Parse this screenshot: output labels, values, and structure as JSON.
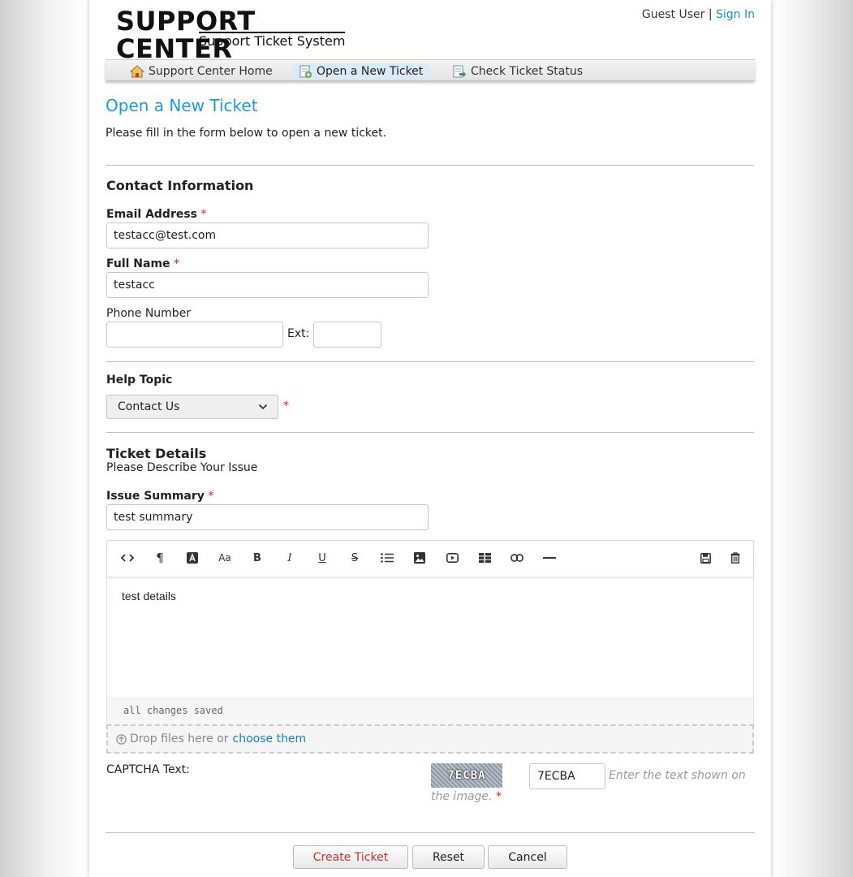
{
  "header": {
    "logo_title": "SUPPORT CENTER",
    "logo_subtitle": "Support Ticket System",
    "user_label": "Guest User |",
    "sign_in": "Sign In"
  },
  "nav": [
    {
      "label": "Support Center Home",
      "icon": "home-icon",
      "active": false
    },
    {
      "label": "Open a New Ticket",
      "icon": "new-ticket-icon",
      "active": true
    },
    {
      "label": "Check Ticket Status",
      "icon": "ticket-status-icon",
      "active": false
    }
  ],
  "page": {
    "title": "Open a New Ticket",
    "intro": "Please fill in the form below to open a new ticket."
  },
  "contact": {
    "heading": "Contact Information",
    "email_label": "Email Address",
    "email_value": "testacc@test.com",
    "name_label": "Full Name",
    "name_value": "testacc",
    "phone_label": "Phone Number",
    "phone_value": "",
    "ext_label": "Ext:",
    "ext_value": ""
  },
  "help_topic": {
    "label": "Help Topic",
    "selected": "Contact Us"
  },
  "ticket": {
    "heading": "Ticket Details",
    "subheading": "Please Describe Your Issue",
    "summary_label": "Issue Summary",
    "summary_value": "test summary",
    "details": "test details",
    "status": "all changes saved"
  },
  "toolbar_icons": [
    "code-view-icon",
    "paragraph-icon",
    "font-color-icon",
    "font-size-icon",
    "bold-icon",
    "italic-icon",
    "underline-icon",
    "strikethrough-icon",
    "bulleted-list-icon",
    "image-icon",
    "video-icon",
    "table-icon",
    "link-icon",
    "horizontal-rule-icon",
    "save-draft-icon",
    "delete-draft-icon"
  ],
  "attachments": {
    "drop_text": "Drop files here or",
    "choose_link": "choose them"
  },
  "captcha": {
    "label": "CAPTCHA Text:",
    "image_text": "7ECBA",
    "value": "7ECBA",
    "hint_line1": "Enter the text shown on",
    "hint_line2": "the image."
  },
  "buttons": {
    "create": "Create Ticket",
    "reset": "Reset",
    "cancel": "Cancel"
  },
  "colors": {
    "accent": "#1e9ad6",
    "required": "#e02020",
    "link": "#1e7fb8"
  }
}
